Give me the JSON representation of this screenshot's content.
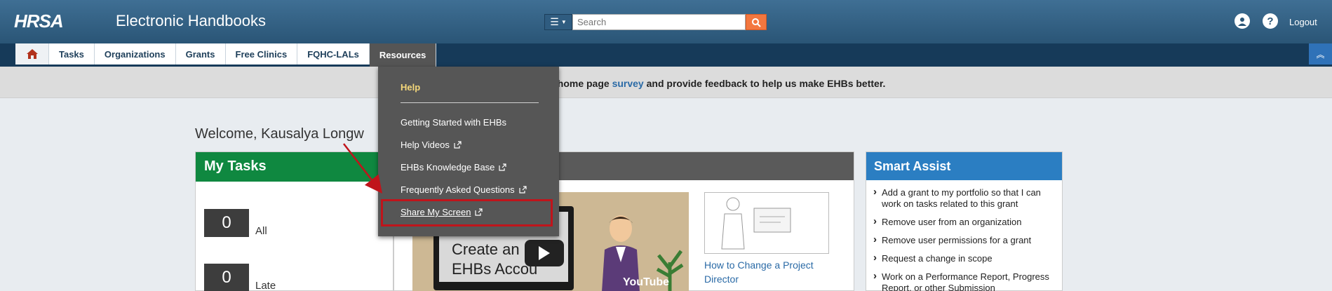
{
  "header": {
    "logo_text": "HRSA",
    "app_title": "Electronic Handbooks",
    "search_placeholder": "Search",
    "logout_label": "Logout",
    "user_icon": "user-circle-icon",
    "help_icon": "question-circle-icon"
  },
  "nav": {
    "home_icon": "home-icon",
    "tabs": [
      "Tasks",
      "Organizations",
      "Grants",
      "Free Clinics",
      "FQHC-LALs",
      "Resources"
    ],
    "active_tab": "Resources"
  },
  "announcement": {
    "text_before": "w home page ",
    "link": "survey",
    "text_after": " and provide feedback to help us make EHBs better."
  },
  "welcome": "Welcome, Kausalya Longw",
  "tasks": {
    "title": "My Tasks",
    "counts": [
      {
        "value": "0",
        "label": "All"
      },
      {
        "value": "0",
        "label": "Late"
      }
    ]
  },
  "video": {
    "thumb_text": "Create an\nEHBs Accou",
    "yt_label": "YouTube",
    "doc_link": "How to Change a Project Director"
  },
  "smart_assist": {
    "title": "Smart Assist",
    "items": [
      "Add a grant to my portfolio so that I can work on tasks related to this grant",
      "Remove user from an organization",
      "Remove user permissions for a grant",
      "Request a change in scope",
      "Work on a Performance Report, Progress Report, or other Submission"
    ]
  },
  "resources_menu": {
    "heading": "Help",
    "items": [
      "Getting Started with EHBs",
      "Help Videos",
      "EHBs Knowledge Base",
      "Frequently Asked Questions",
      "Share My Screen"
    ],
    "highlighted": "Share My Screen"
  },
  "colors": {
    "header": "#2a5576",
    "nav": "#163a59",
    "tasks_header": "#0f8840",
    "smart_header": "#2b7ec2",
    "search_button": "#f3773f",
    "menu_heading": "#f4d77a",
    "highlight": "#c0141b"
  }
}
